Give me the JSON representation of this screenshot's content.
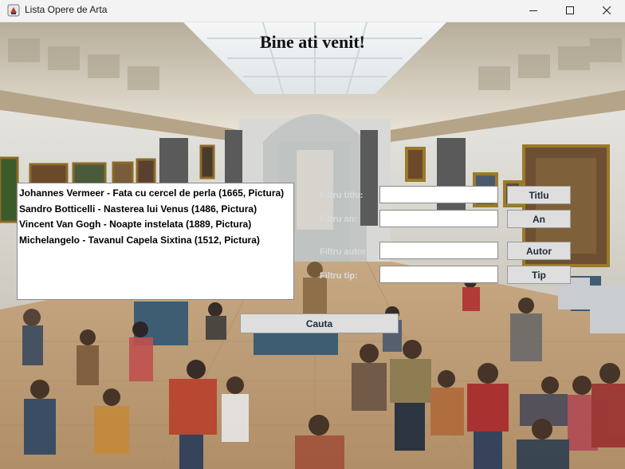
{
  "window": {
    "title": "Lista Opere de Arta",
    "app_icon": "java-cup-icon",
    "controls": [
      "minimize-icon",
      "maximize-icon",
      "close-icon"
    ]
  },
  "header": {
    "welcome": "Bine ati venit!"
  },
  "results": [
    "Johannes Vermeer - Fata cu cercel de perla (1665, Pictura)",
    "Sandro Botticelli - Nasterea lui Venus (1486, Pictura)",
    "Vincent Van Gogh - Noapte instelata (1889, Pictura)",
    "Michelangelo - Tavanul Capela Sixtina (1512, Pictura)"
  ],
  "filters": {
    "title": {
      "label": "Filtru titlu:",
      "value": "",
      "button": "Titlu"
    },
    "year": {
      "label": "Filtru an:",
      "value": "",
      "button": "An"
    },
    "author": {
      "label": "Filtru autor:",
      "value": "",
      "button": "Autor"
    },
    "type": {
      "label": "Filtru tip:",
      "value": "",
      "button": "Tip"
    }
  },
  "search_button": "Cauta",
  "colors": {
    "label_text": "#d8dcdf",
    "button_bg": "#dedede",
    "button_text": "#1d2a3a"
  }
}
